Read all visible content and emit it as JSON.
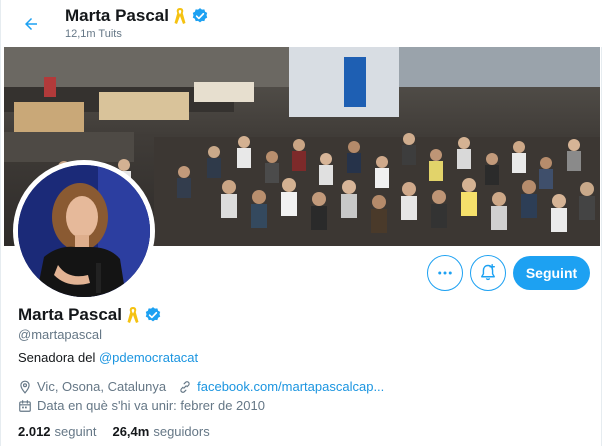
{
  "header": {
    "name": "Marta Pascal",
    "tweet_count": "12,1m Tuits"
  },
  "profile": {
    "name": "Marta Pascal",
    "handle": "@martapascal",
    "bio_prefix": "Senadora del ",
    "bio_link": "@pdemocratacat",
    "location": "Vic, Osona, Catalunya",
    "website": "facebook.com/martapascalcap...",
    "joined": "Data en què s'hi va unir: febrer de 2010",
    "following_count": "2.012",
    "following_label": "seguint",
    "followers_count": "26,4m",
    "followers_label": "seguidors"
  },
  "actions": {
    "follow_label": "Seguint"
  },
  "colors": {
    "accent": "#1da1f2",
    "link": "#1b95e0",
    "muted": "#657786",
    "ribbon": "#f5c211",
    "verified": "#1da1f2"
  }
}
